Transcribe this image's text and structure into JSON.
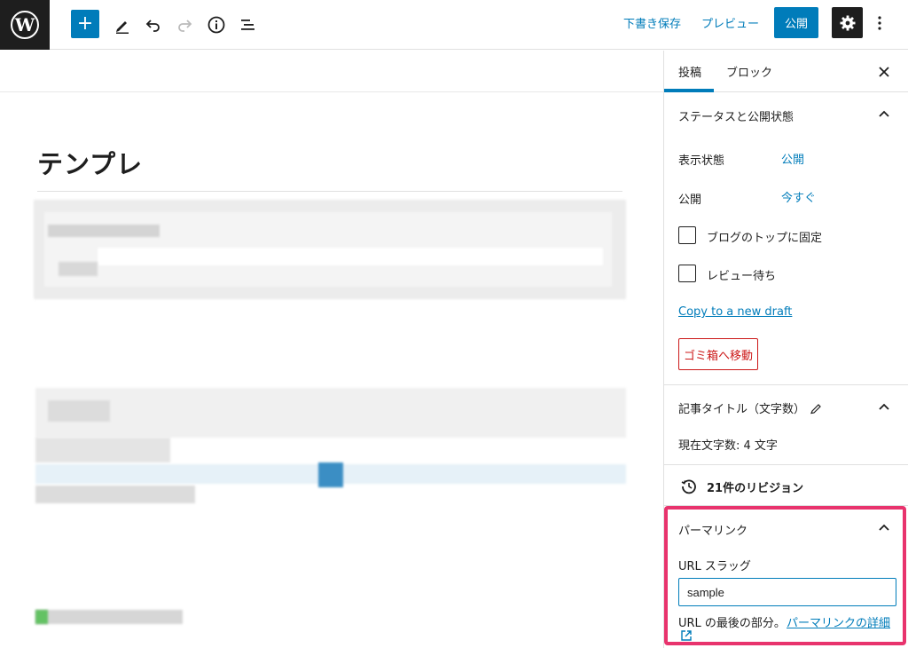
{
  "toolbar": {
    "save_draft_label": "下書き保存",
    "preview_label": "プレビュー",
    "publish_label": "公開"
  },
  "editor": {
    "post_title": "テンプレ"
  },
  "sidebar": {
    "tabs": [
      "投稿",
      "ブロック"
    ],
    "status_panel": {
      "title": "ステータスと公開状態",
      "visibility_label": "表示状態",
      "visibility_value": "公開",
      "publish_label": "公開",
      "publish_value": "今すぐ",
      "sticky_label": "ブログのトップに固定",
      "pending_label": "レビュー待ち",
      "copy_draft_link": "Copy to a new draft",
      "trash_label": "ゴミ箱へ移動"
    },
    "title_count_panel": {
      "title": "記事タイトル（文字数）",
      "count_text": "現在文字数: 4 文字"
    },
    "revisions": {
      "label": "21件のリビジョン"
    },
    "permalink_panel": {
      "title": "パーマリンク",
      "slug_label": "URL スラッグ",
      "slug_value": "sample",
      "help_text": "URL の最後の部分。",
      "help_link": "パーマリンクの詳細"
    }
  },
  "colors": {
    "accent": "#007cba",
    "highlight": "#e8336d",
    "danger": "#cc1818"
  },
  "icons": [
    "wordpress-logo-icon",
    "plus-icon",
    "pencil-icon",
    "undo-icon",
    "redo-icon",
    "info-icon",
    "list-view-icon",
    "gear-icon",
    "more-vertical-icon",
    "close-icon",
    "chevron-up-icon",
    "history-icon",
    "external-link-icon"
  ]
}
